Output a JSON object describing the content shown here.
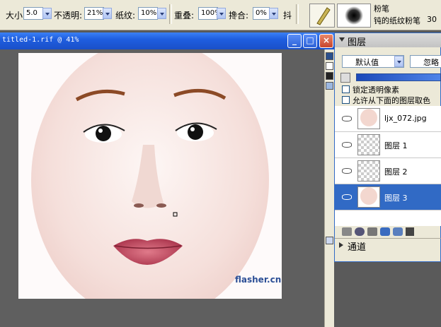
{
  "property_bar": {
    "size_label": "大小",
    "size_value": "5.0",
    "opacity_label": "不透明:",
    "opacity_value": "21%",
    "texture_label": "纸纹:",
    "texture_value": "10%",
    "overlap_label": "重叠:",
    "overlap_value": "100%",
    "blend_label": "搀合:",
    "blend_value": "0%",
    "jitter_label": "抖",
    "brush_category": "粉笔",
    "brush_variant": "钝的纸纹粉笔",
    "brush_size": "30"
  },
  "document": {
    "title": "titled-1.rif @ 41%",
    "watermark": "flasher.cn"
  },
  "layers_panel": {
    "title": "图层",
    "composite_method": "默认值",
    "ignore_label": "忽略",
    "pick_up_label": "锁定透明像素",
    "pick_below_label": "允许从下面的图层取色",
    "layers": [
      {
        "name": "ljx_072.jpg",
        "visible": true,
        "selected": false,
        "thumb": "face"
      },
      {
        "name": "图层 1",
        "visible": true,
        "selected": false,
        "thumb": "transparent"
      },
      {
        "name": "图层 2",
        "visible": true,
        "selected": false,
        "thumb": "transparent"
      },
      {
        "name": "图层 3",
        "visible": true,
        "selected": true,
        "thumb": "face"
      }
    ],
    "channels_label": "通道"
  }
}
